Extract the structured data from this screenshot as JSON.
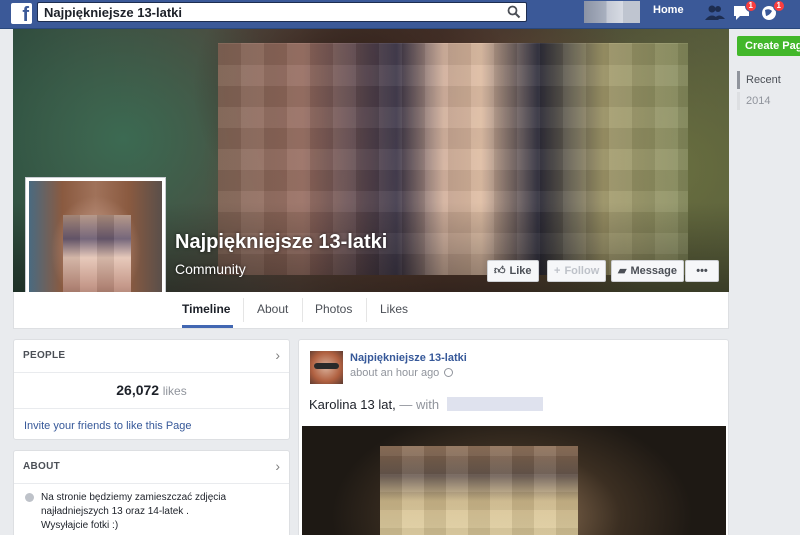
{
  "topbar": {
    "search_value": "Najpiękniejsze 13-latki",
    "home_label": "Home",
    "notifications": {
      "messages_count": "1",
      "global_count": "1"
    }
  },
  "page": {
    "title": "Najpiękniejsze 13-latki",
    "category": "Community"
  },
  "actions": {
    "like_label": "Like",
    "follow_label": "Follow",
    "message_label": "Message",
    "more_label": "•••"
  },
  "tabs": [
    {
      "label": "Timeline"
    },
    {
      "label": "About"
    },
    {
      "label": "Photos"
    },
    {
      "label": "Likes"
    }
  ],
  "right_rail": {
    "create_page_label": "Create Page",
    "years": [
      "Recent",
      "2014"
    ]
  },
  "people_card": {
    "header": "PEOPLE",
    "likes_count": "26,072",
    "likes_word": "likes",
    "invite_text": "Invite your friends to like this Page"
  },
  "about_card": {
    "header": "ABOUT",
    "description_line1": "Na stronie będziemy zamieszczać zdjęcia",
    "description_line2": "najładniejszych 13 oraz 14-latek .",
    "description_line3": "Wysyłajcie fotki :)"
  },
  "post": {
    "author": "Najpiękniejsze 13-latki",
    "time": "about an hour ago",
    "text": "Karolina 13 lat,",
    "with_text": "— with"
  },
  "colors": {
    "topbar": "#3b5998",
    "link": "#365899",
    "create_page": "#42b72a",
    "badge": "#fa3e3e"
  },
  "icons": [
    "facebook-logo-icon",
    "search-icon",
    "friend-requests-icon",
    "messages-icon",
    "globe-notifications-icon",
    "like-thumb-icon",
    "plus-icon",
    "message-icon",
    "chevron-right-icon",
    "info-icon",
    "globe-icon"
  ]
}
